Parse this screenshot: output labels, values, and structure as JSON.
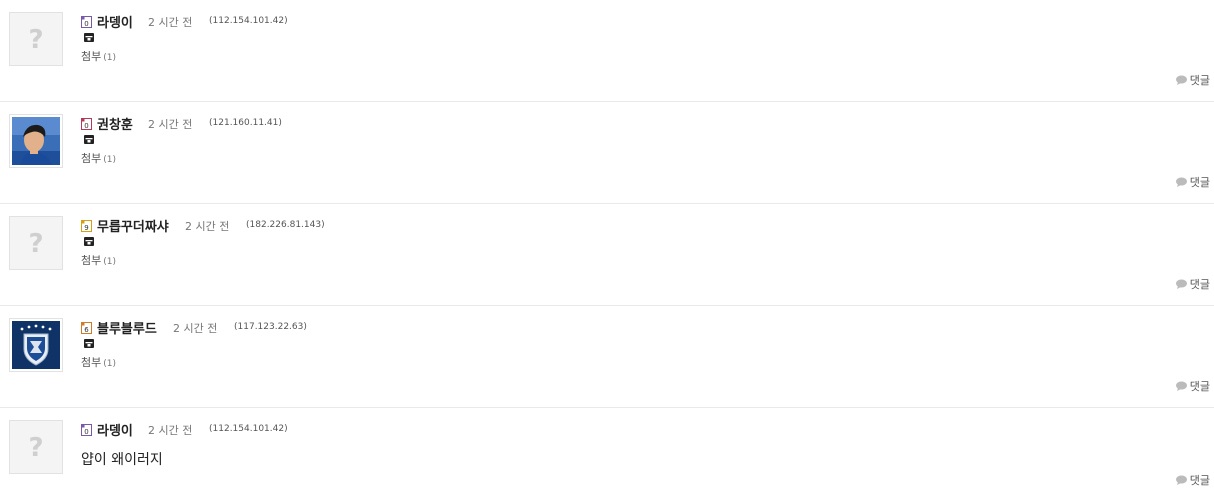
{
  "comments": [
    {
      "nickname": "라뎅이",
      "time": "2 시간 전",
      "ip": "(112.154.101.42)",
      "avatar": "placeholder",
      "avatar_glyph": "?",
      "level_color": "#7a5aa8",
      "has_file_icon": true,
      "attachment_label": "첨부",
      "attachment_count": "(1)",
      "reply_label": "댓글"
    },
    {
      "nickname": "권창훈",
      "time": "2 시간 전",
      "ip": "(121.160.11.41)",
      "avatar": "player-photo",
      "level_color": "#b33a5a",
      "has_file_icon": true,
      "attachment_label": "첨부",
      "attachment_count": "(1)",
      "reply_label": "댓글"
    },
    {
      "nickname": "무릅꾸더짜샤",
      "time": "2 시간 전",
      "ip": "(182.226.81.143)",
      "avatar": "placeholder",
      "avatar_glyph": "?",
      "level_color": "#d4a017",
      "has_file_icon": true,
      "attachment_label": "첨부",
      "attachment_count": "(1)",
      "reply_label": "댓글"
    },
    {
      "nickname": "블루블루드",
      "time": "2 시간 전",
      "ip": "(117.123.22.63)",
      "avatar": "club-emblem",
      "level_color": "#d07a2a",
      "has_file_icon": true,
      "attachment_label": "첨부",
      "attachment_count": "(1)",
      "reply_label": "댓글"
    },
    {
      "nickname": "라뎅이",
      "time": "2 시간 전",
      "ip": "(112.154.101.42)",
      "avatar": "placeholder",
      "avatar_glyph": "?",
      "level_color": "#7a5aa8",
      "has_file_icon": false,
      "body": "얍이 왜이러지",
      "reply_label": "댓글"
    }
  ]
}
